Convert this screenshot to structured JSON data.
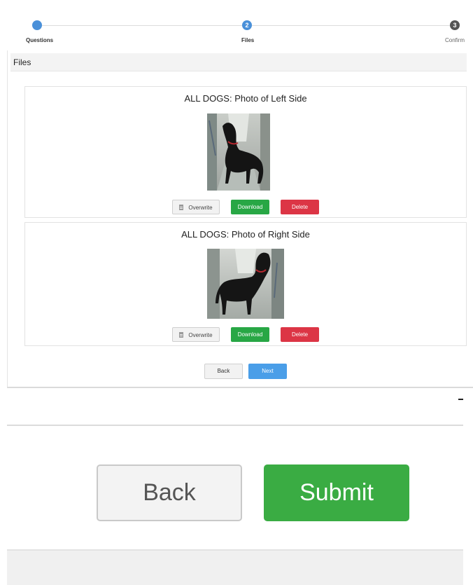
{
  "stepper": {
    "steps": [
      {
        "number": "",
        "label": "Questions",
        "state": "done"
      },
      {
        "number": "2",
        "label": "Files",
        "state": "active"
      },
      {
        "number": "3",
        "label": "Confirm",
        "state": "todo"
      }
    ]
  },
  "section": {
    "title": "Files"
  },
  "files": [
    {
      "title": "ALL DOGS: Photo of Left Side",
      "image_icon": "dog-photo-icon",
      "overwrite_label": "Overwrite",
      "download_label": "Download",
      "delete_label": "Delete"
    },
    {
      "title": "ALL DOGS: Photo of Right Side",
      "image_icon": "dog-photo-icon",
      "overwrite_label": "Overwrite",
      "download_label": "Download",
      "delete_label": "Delete"
    }
  ],
  "nav": {
    "back_label": "Back",
    "next_label": "Next"
  },
  "zoom": {
    "back_label": "Back",
    "submit_label": "Submit"
  },
  "colors": {
    "step_active": "#4a90d9",
    "download": "#28a745",
    "delete": "#dc3545",
    "next": "#4a9ee8",
    "submit": "#3aac43"
  }
}
